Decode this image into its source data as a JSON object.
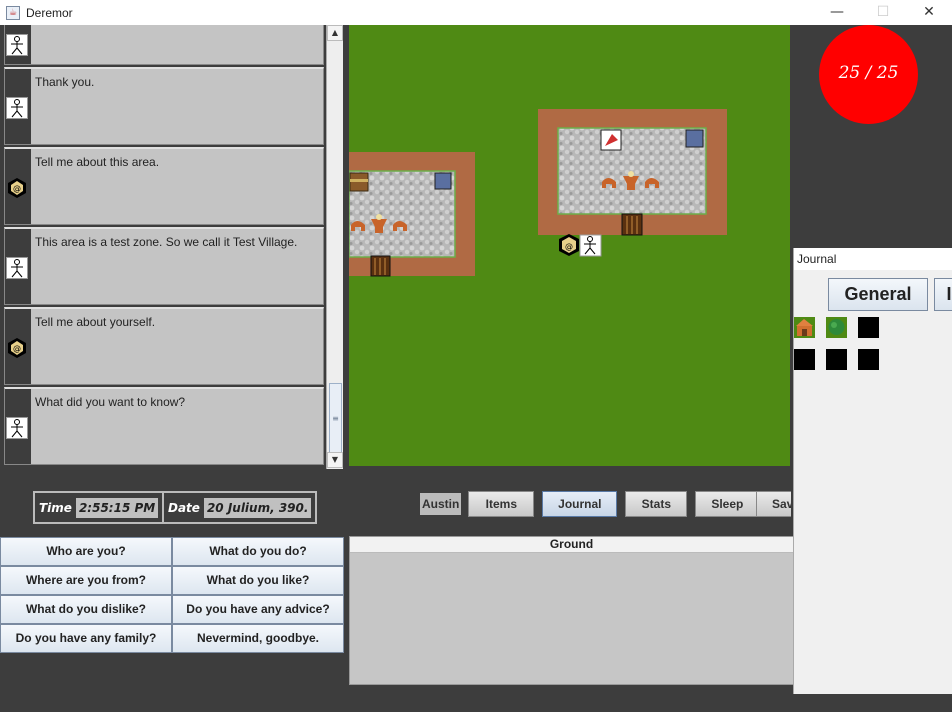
{
  "window": {
    "title": "Deremor",
    "min": "—",
    "max": "☐",
    "close": "✕"
  },
  "chat": {
    "messages": [
      {
        "speaker": "npc",
        "text": ""
      },
      {
        "speaker": "npc",
        "text": "Thank you."
      },
      {
        "speaker": "player",
        "text": "Tell me about this area."
      },
      {
        "speaker": "npc",
        "text": "This area is a test zone. So we call it Test Village."
      },
      {
        "speaker": "player",
        "text": "Tell me about yourself."
      },
      {
        "speaker": "npc",
        "text": "What did you want to know?"
      }
    ]
  },
  "clock": {
    "time_label": "Time",
    "time": "2:55:15 PM",
    "date_label": "Date",
    "date": "20 Julium, 390."
  },
  "questions": [
    "Who are you?",
    "What do you do?",
    "Where are you from?",
    "What do you like?",
    "What do you dislike?",
    "Do you have any advice?",
    "Do you have any family?",
    "Nevermind, goodbye."
  ],
  "toolbar": {
    "player_name": "Austin",
    "buttons": [
      "Items",
      "Journal",
      "Stats",
      "Sleep",
      "Save"
    ],
    "selected": "Journal"
  },
  "ground": {
    "title": "Ground"
  },
  "hp": {
    "text": "25 / 25"
  },
  "journal": {
    "title": "Journal",
    "tab_general": "General",
    "tab_next": "I"
  },
  "colors": {
    "grass": "#4f8a14",
    "hp": "#ff0000",
    "dirt": "#b06a44"
  }
}
